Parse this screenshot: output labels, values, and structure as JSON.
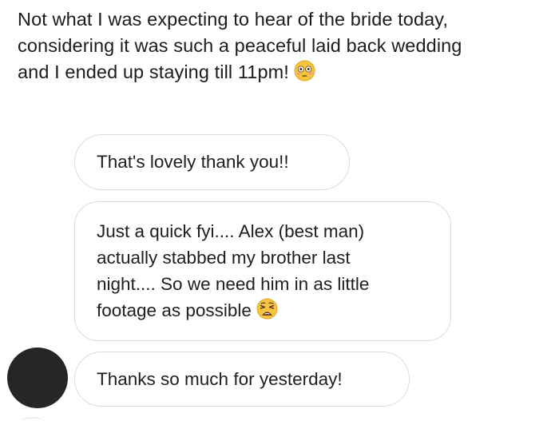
{
  "caption": {
    "lines": [
      "Not what I was expecting to hear of the bride today,",
      "considering it was such a peaceful laid back wedding",
      "and I ended up staying till 11pm!"
    ],
    "emoji": "flushed-face-emoji"
  },
  "messages": [
    {
      "lines": [
        "That's lovely thank you!!"
      ]
    },
    {
      "lines": [
        "Just a quick fyi.... Alex (best man)",
        "actually stabbed my brother last",
        "night.... So we need him in as little",
        "footage as possible"
      ],
      "emoji": "weary-face-emoji"
    },
    {
      "lines": [
        "Thanks so much for yesterday!"
      ]
    }
  ],
  "colors": {
    "avatar": "#262626",
    "bubble_border": "#dcdcdc",
    "text": "#1c1c1c",
    "emoji_yellow": "#f7c440"
  }
}
